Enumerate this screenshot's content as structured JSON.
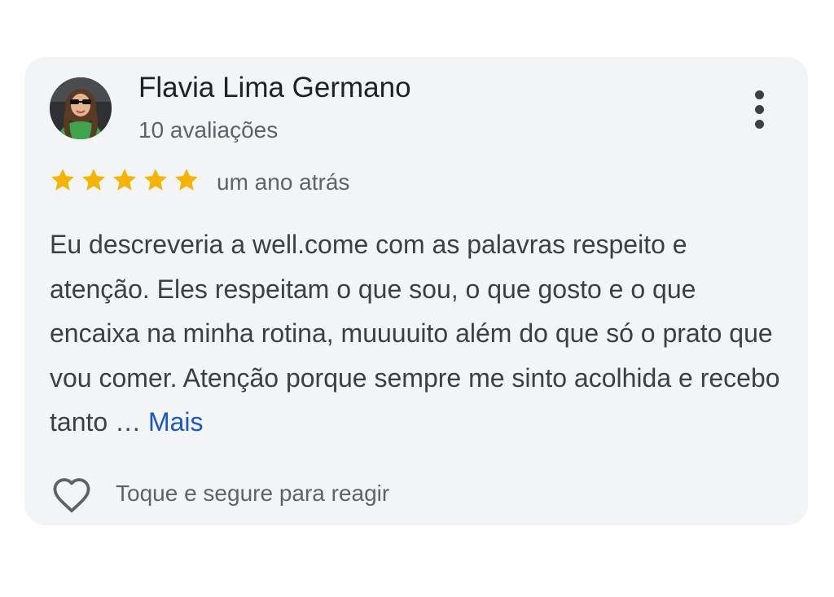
{
  "review": {
    "author": {
      "name": "Flavia Lima Germano",
      "review_count": "10 avaliações",
      "avatar": "profile-photo"
    },
    "rating": 5,
    "max_rating": 5,
    "date": "um ano atrás",
    "text": "Eu descreveria a well.come com as palavras respeito e atenção. Eles respeitam o que sou, o que gosto e o que encaixa na minha rotina, muuuuito além do que só o prato que vou comer. Atenção porque sempre me sinto acolhida e recebo tanto …",
    "more_label": "Mais",
    "react_hint": "Toque e segure para reagir"
  },
  "icons": {
    "star": "star-icon",
    "menu": "more-vert-icon",
    "heart": "heart-outline-icon"
  },
  "colors": {
    "card_background": "#f3f4f6",
    "star": "#f4b400",
    "link": "#1a57c8",
    "primary_text": "#202124",
    "secondary_text": "#5f6368"
  }
}
